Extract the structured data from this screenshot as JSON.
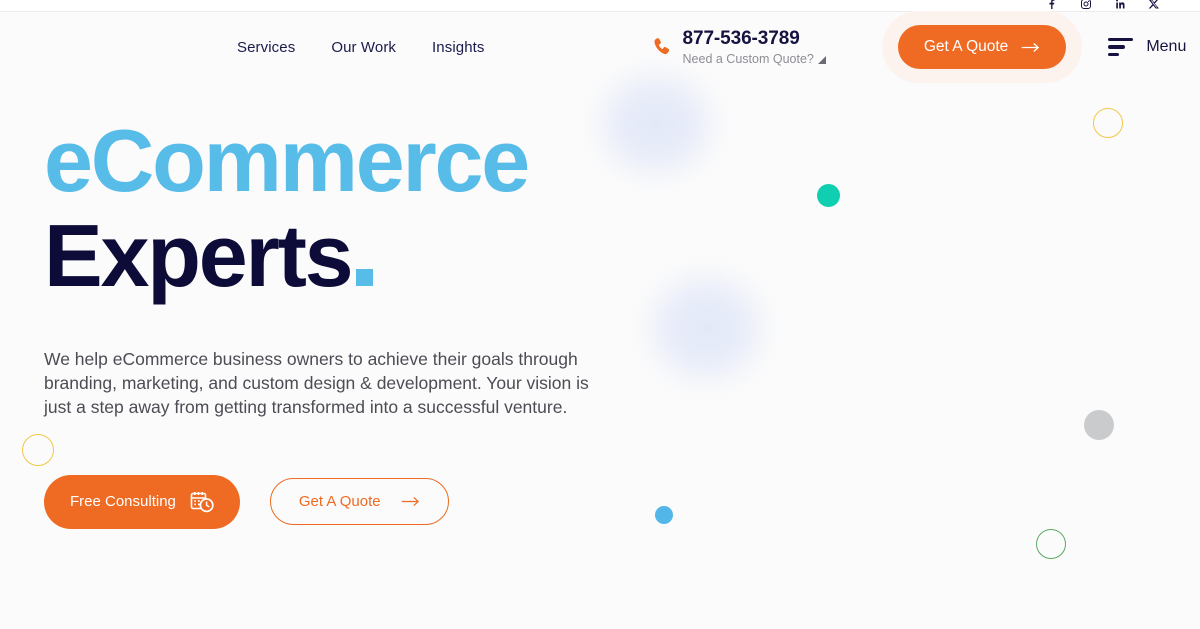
{
  "topbar": {
    "social": [
      {
        "name": "facebook-icon",
        "label": "Facebook"
      },
      {
        "name": "instagram-icon",
        "label": "Instagram"
      },
      {
        "name": "linkedin-icon",
        "label": "LinkedIn"
      },
      {
        "name": "x-twitter-icon",
        "label": "X"
      }
    ]
  },
  "header": {
    "nav": [
      {
        "label": "Services"
      },
      {
        "label": "Our Work"
      },
      {
        "label": "Insights"
      }
    ],
    "phone": {
      "number": "877-536-3789",
      "subtitle": "Need a Custom Quote?"
    },
    "quote_button": {
      "label": "Get A Quote"
    },
    "menu": {
      "label": "Menu"
    }
  },
  "hero": {
    "heading_line1": "eCommerce",
    "heading_line2": "Experts",
    "paragraph": "We help eCommerce business owners to achieve their goals through branding, marketing, and custom design & development. Your vision is just a step away from getting transformed into a successful venture.",
    "cta_primary": {
      "label": "Free Consulting"
    },
    "cta_secondary": {
      "label": "Get A Quote"
    }
  },
  "colors": {
    "brand_orange": "#ef6a22",
    "heading_blue": "#58bce9",
    "heading_navy": "#0d0c38",
    "accent_teal": "#0fcfb0",
    "accent_blue_dot": "#52b7e8",
    "accent_gray_dot": "#c9cbcd",
    "ring_yellow": "#f2c74a",
    "ring_green": "#5aab63",
    "blob_lavender": "#d3dcf7",
    "page_background": "#fbfbfb"
  }
}
